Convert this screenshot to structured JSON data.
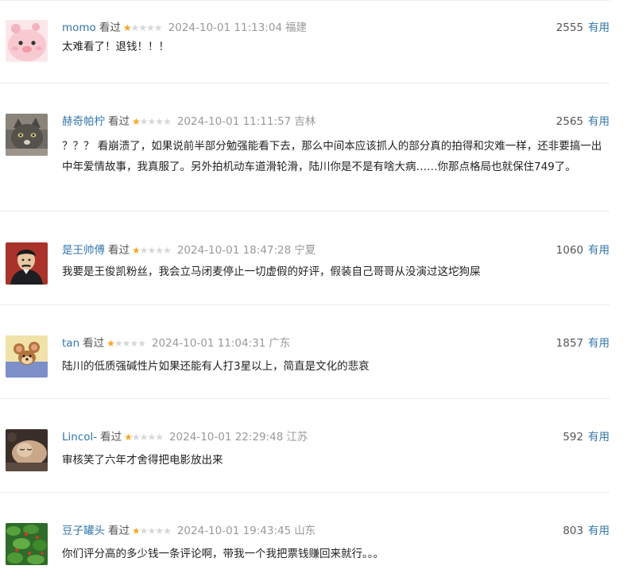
{
  "comments": [
    {
      "username": "momo",
      "watched_label": "看过",
      "rating_stars": 1,
      "rating_max": 5,
      "timestamp": "2024-10-01 11:13:04",
      "location": "福建",
      "votes": "2555",
      "useful_label": "有用",
      "text": "太难看了！退钱！！！",
      "avatar": "pink-cartoon-face-avatar"
    },
    {
      "username": "赫奇帕柠",
      "watched_label": "看过",
      "rating_stars": 1,
      "rating_max": 5,
      "timestamp": "2024-10-01 11:11:57",
      "location": "吉林",
      "votes": "2565",
      "useful_label": "有用",
      "text": "？？？ 看崩溃了，如果说前半部分勉强能看下去，那么中间本应该抓人的部分真的拍得和灾难一样，还非要搞一出中年爱情故事，我真服了。另外拍机动车道滑轮滑，陆川你是不是有啥大病……你那点格局也就保住749了。",
      "avatar": "gray-cat-avatar"
    },
    {
      "username": "是王帅傅",
      "watched_label": "看过",
      "rating_stars": 1,
      "rating_max": 5,
      "timestamp": "2024-10-01 18:47:28",
      "location": "宁夏",
      "votes": "1060",
      "useful_label": "有用",
      "text": "我要是王俊凯粉丝，我会立马闭麦停止一切虚假的好评，假装自己哥哥从没演过这坨狗屎",
      "avatar": "portrait-man-avatar"
    },
    {
      "username": "tan",
      "watched_label": "看过",
      "rating_stars": 1,
      "rating_max": 5,
      "timestamp": "2024-10-01 11:04:31",
      "location": "广东",
      "votes": "1857",
      "useful_label": "有用",
      "text": "陆川的低质强碱性片如果还能有人打3星以上，简直是文化的悲哀",
      "avatar": "cartoon-mouse-avatar"
    },
    {
      "username": "Lincol-",
      "watched_label": "看过",
      "rating_stars": 1,
      "rating_max": 5,
      "timestamp": "2024-10-01 22:29:48",
      "location": "江苏",
      "votes": "592",
      "useful_label": "有用",
      "text": "审核笑了六年才舍得把电影放出来",
      "avatar": "sleeping-cat-avatar"
    },
    {
      "username": "豆子罐头",
      "watched_label": "看过",
      "rating_stars": 1,
      "rating_max": 5,
      "timestamp": "2024-10-01 19:43:45",
      "location": "山东",
      "votes": "803",
      "useful_label": "有用",
      "text": "你们评分高的多少钱一条评论啊，带我一个我把票钱赚回来就行。。。",
      "avatar": "green-leaves-avatar"
    }
  ],
  "colors": {
    "username": "#3377aa",
    "star_on": "#f5a623",
    "star_off": "#d6d6d6",
    "meta_gray": "#999999",
    "divider": "#eaeaea"
  }
}
